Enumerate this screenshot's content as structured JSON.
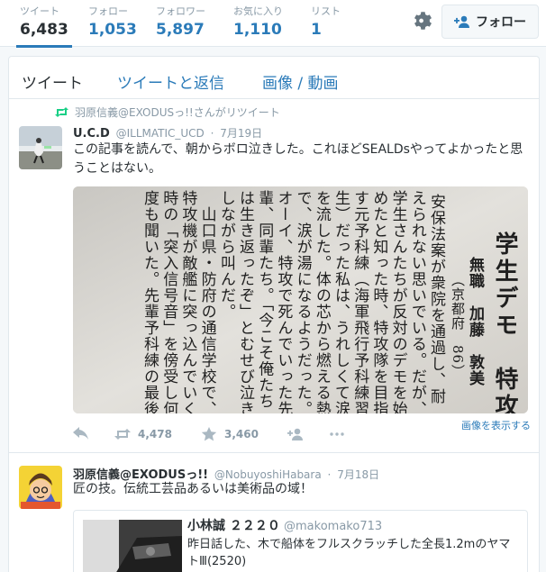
{
  "stats": {
    "tweets": {
      "label": "ツイート",
      "value": "6,483"
    },
    "following": {
      "label": "フォロー",
      "value": "1,053"
    },
    "followers": {
      "label": "フォロワー",
      "value": "5,897"
    },
    "favorites": {
      "label": "お気に入り",
      "value": "1,110"
    },
    "lists": {
      "label": "リスト",
      "value": "1"
    }
  },
  "follow_button": {
    "label": "フォロー"
  },
  "tabs": [
    "ツイート",
    "ツイートと返信",
    "画像 / 動画"
  ],
  "tweet1": {
    "context": "羽原信義@EXODUSっ!!さんがリツイート",
    "name": "U.C.D",
    "screen_name": "@ILLMATIC_UCD",
    "dot": "·",
    "time": "7月19日",
    "text": "この記事を読んで、朝からボロ泣きした。これほどSEALDsやってよかったと思うことはない。",
    "view_image": "画像を表示する",
    "retweets": "4,478",
    "likes": "3,460",
    "newspaper": {
      "headline": "学生デモ　特攻の無",
      "author": "無職　加藤　敦美",
      "location": "（京都府　86）",
      "lines": [
        "安保法案が衆院を通過し、耐",
        "えられない思いでいる。だが、",
        "学生さんたちが反対のデモを始",
        "めたと知った時、特攻隊を目指",
        "す元予科練（海軍飛行予科練習",
        "生）だった私は、うれしくて涙",
        "を流した。体の芯から燃える熱",
        "で、涙が湯になるようだった。",
        "オーイ、特攻で死んでいった先",
        "輩、同輩たち。「今こそ俺たち",
        "は生き返ったぞ」とむせび泣き",
        "しながら叫んだ。",
        "　山口県・防府の通信学校で、",
        "特攻機が敵艦に突っ込んでいく",
        "時の「突入信号音」を傍受し何",
        "度も聞いた。先輩予科練の最後"
      ]
    }
  },
  "tweet2": {
    "name": "羽原信義@EXODUSっ!!",
    "screen_name": "@NobuyoshiHabara",
    "dot": "·",
    "time": "7月18日",
    "text": "匠の技。伝統工芸品あるいは美術品の域！",
    "quote": {
      "name": "小林誠 ２２２０",
      "screen_name": "@makomako713",
      "text": "昨日話した、木で船体をフルスクラッチした全長1.2mのヤマトⅢ(2520)"
    }
  }
}
